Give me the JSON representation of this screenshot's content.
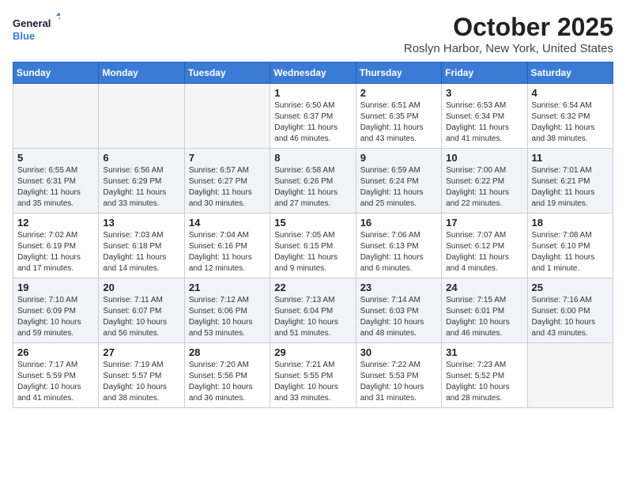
{
  "logo": {
    "line1": "General",
    "line2": "Blue"
  },
  "title": "October 2025",
  "location": "Roslyn Harbor, New York, United States",
  "weekdays": [
    "Sunday",
    "Monday",
    "Tuesday",
    "Wednesday",
    "Thursday",
    "Friday",
    "Saturday"
  ],
  "weeks": [
    [
      {
        "day": "",
        "info": ""
      },
      {
        "day": "",
        "info": ""
      },
      {
        "day": "",
        "info": ""
      },
      {
        "day": "1",
        "info": "Sunrise: 6:50 AM\nSunset: 6:37 PM\nDaylight: 11 hours\nand 46 minutes."
      },
      {
        "day": "2",
        "info": "Sunrise: 6:51 AM\nSunset: 6:35 PM\nDaylight: 11 hours\nand 43 minutes."
      },
      {
        "day": "3",
        "info": "Sunrise: 6:53 AM\nSunset: 6:34 PM\nDaylight: 11 hours\nand 41 minutes."
      },
      {
        "day": "4",
        "info": "Sunrise: 6:54 AM\nSunset: 6:32 PM\nDaylight: 11 hours\nand 38 minutes."
      }
    ],
    [
      {
        "day": "5",
        "info": "Sunrise: 6:55 AM\nSunset: 6:31 PM\nDaylight: 11 hours\nand 35 minutes."
      },
      {
        "day": "6",
        "info": "Sunrise: 6:56 AM\nSunset: 6:29 PM\nDaylight: 11 hours\nand 33 minutes."
      },
      {
        "day": "7",
        "info": "Sunrise: 6:57 AM\nSunset: 6:27 PM\nDaylight: 11 hours\nand 30 minutes."
      },
      {
        "day": "8",
        "info": "Sunrise: 6:58 AM\nSunset: 6:26 PM\nDaylight: 11 hours\nand 27 minutes."
      },
      {
        "day": "9",
        "info": "Sunrise: 6:59 AM\nSunset: 6:24 PM\nDaylight: 11 hours\nand 25 minutes."
      },
      {
        "day": "10",
        "info": "Sunrise: 7:00 AM\nSunset: 6:22 PM\nDaylight: 11 hours\nand 22 minutes."
      },
      {
        "day": "11",
        "info": "Sunrise: 7:01 AM\nSunset: 6:21 PM\nDaylight: 11 hours\nand 19 minutes."
      }
    ],
    [
      {
        "day": "12",
        "info": "Sunrise: 7:02 AM\nSunset: 6:19 PM\nDaylight: 11 hours\nand 17 minutes."
      },
      {
        "day": "13",
        "info": "Sunrise: 7:03 AM\nSunset: 6:18 PM\nDaylight: 11 hours\nand 14 minutes."
      },
      {
        "day": "14",
        "info": "Sunrise: 7:04 AM\nSunset: 6:16 PM\nDaylight: 11 hours\nand 12 minutes."
      },
      {
        "day": "15",
        "info": "Sunrise: 7:05 AM\nSunset: 6:15 PM\nDaylight: 11 hours\nand 9 minutes."
      },
      {
        "day": "16",
        "info": "Sunrise: 7:06 AM\nSunset: 6:13 PM\nDaylight: 11 hours\nand 6 minutes."
      },
      {
        "day": "17",
        "info": "Sunrise: 7:07 AM\nSunset: 6:12 PM\nDaylight: 11 hours\nand 4 minutes."
      },
      {
        "day": "18",
        "info": "Sunrise: 7:08 AM\nSunset: 6:10 PM\nDaylight: 11 hours\nand 1 minute."
      }
    ],
    [
      {
        "day": "19",
        "info": "Sunrise: 7:10 AM\nSunset: 6:09 PM\nDaylight: 10 hours\nand 59 minutes."
      },
      {
        "day": "20",
        "info": "Sunrise: 7:11 AM\nSunset: 6:07 PM\nDaylight: 10 hours\nand 56 minutes."
      },
      {
        "day": "21",
        "info": "Sunrise: 7:12 AM\nSunset: 6:06 PM\nDaylight: 10 hours\nand 53 minutes."
      },
      {
        "day": "22",
        "info": "Sunrise: 7:13 AM\nSunset: 6:04 PM\nDaylight: 10 hours\nand 51 minutes."
      },
      {
        "day": "23",
        "info": "Sunrise: 7:14 AM\nSunset: 6:03 PM\nDaylight: 10 hours\nand 48 minutes."
      },
      {
        "day": "24",
        "info": "Sunrise: 7:15 AM\nSunset: 6:01 PM\nDaylight: 10 hours\nand 46 minutes."
      },
      {
        "day": "25",
        "info": "Sunrise: 7:16 AM\nSunset: 6:00 PM\nDaylight: 10 hours\nand 43 minutes."
      }
    ],
    [
      {
        "day": "26",
        "info": "Sunrise: 7:17 AM\nSunset: 5:59 PM\nDaylight: 10 hours\nand 41 minutes."
      },
      {
        "day": "27",
        "info": "Sunrise: 7:19 AM\nSunset: 5:57 PM\nDaylight: 10 hours\nand 38 minutes."
      },
      {
        "day": "28",
        "info": "Sunrise: 7:20 AM\nSunset: 5:56 PM\nDaylight: 10 hours\nand 36 minutes."
      },
      {
        "day": "29",
        "info": "Sunrise: 7:21 AM\nSunset: 5:55 PM\nDaylight: 10 hours\nand 33 minutes."
      },
      {
        "day": "30",
        "info": "Sunrise: 7:22 AM\nSunset: 5:53 PM\nDaylight: 10 hours\nand 31 minutes."
      },
      {
        "day": "31",
        "info": "Sunrise: 7:23 AM\nSunset: 5:52 PM\nDaylight: 10 hours\nand 28 minutes."
      },
      {
        "day": "",
        "info": ""
      }
    ]
  ]
}
